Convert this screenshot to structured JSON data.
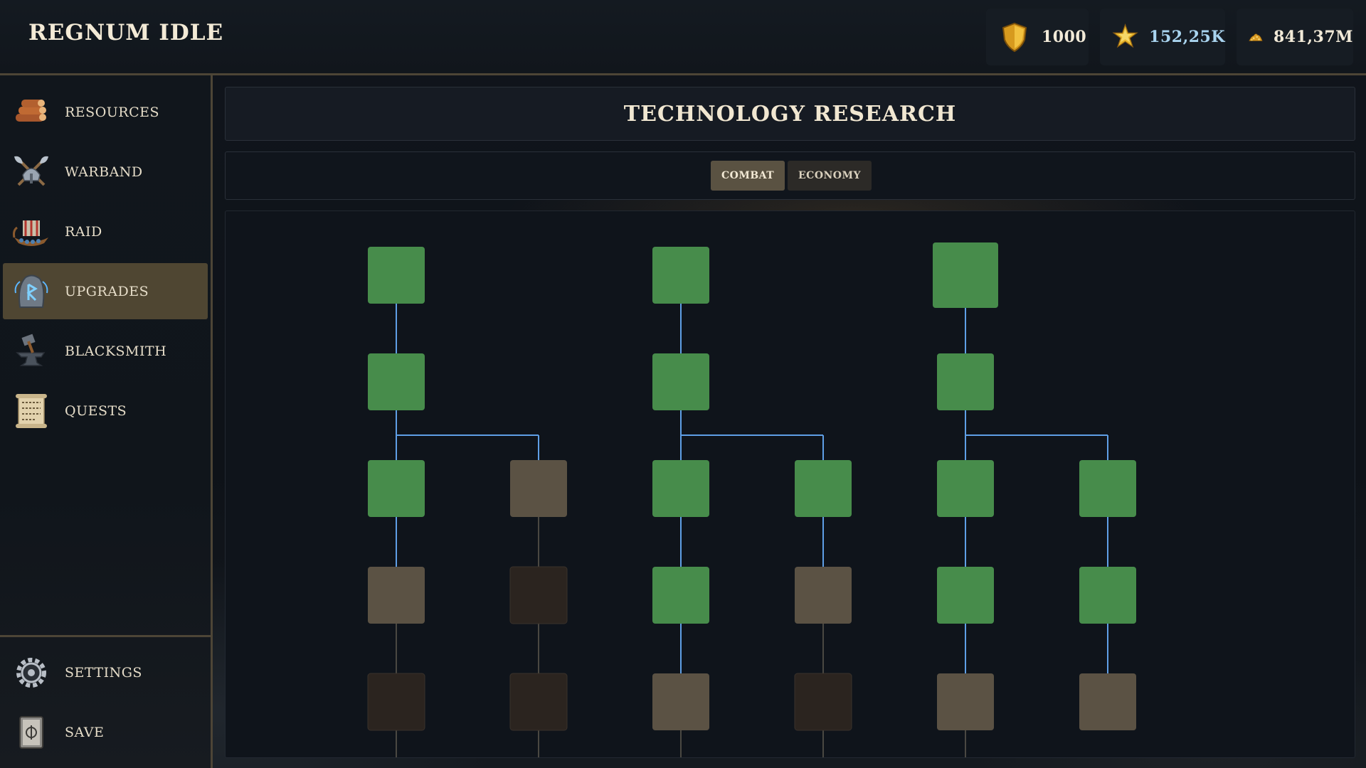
{
  "app": {
    "title": "REGNUM IDLE"
  },
  "resources": [
    {
      "name": "shield",
      "icon": "shield-icon",
      "value": "1000",
      "color": "#f2ead8"
    },
    {
      "name": "star",
      "icon": "star-icon",
      "value": "152,25K",
      "color": "#a9d4ef"
    },
    {
      "name": "gold",
      "icon": "gold-pile-icon",
      "value": "841,37M",
      "color": "#f2ead8"
    }
  ],
  "sidebar": {
    "items": [
      {
        "id": "resources",
        "label": "RESOURCES",
        "icon": "logs-icon",
        "active": false
      },
      {
        "id": "warband",
        "label": "WARBAND",
        "icon": "crossed-axes-helmet-icon",
        "active": false
      },
      {
        "id": "raid",
        "label": "RAID",
        "icon": "longship-icon",
        "active": false
      },
      {
        "id": "upgrades",
        "label": "UPGRADES",
        "icon": "rune-stone-icon",
        "active": true
      },
      {
        "id": "blacksmith",
        "label": "BLACKSMITH",
        "icon": "anvil-hammer-icon",
        "active": false
      },
      {
        "id": "quests",
        "label": "QUESTS",
        "icon": "scroll-icon",
        "active": false
      }
    ],
    "bottom_items": [
      {
        "id": "settings",
        "label": "SETTINGS",
        "icon": "gear-icon"
      },
      {
        "id": "save",
        "label": "SAVE",
        "icon": "book-icon"
      }
    ]
  },
  "main": {
    "title": "TECHNOLOGY RESEARCH",
    "tabs": [
      {
        "label": "COMBAT",
        "active": true
      },
      {
        "label": "ECONOMY",
        "active": false
      }
    ]
  },
  "colors": {
    "researched": "#478c4b",
    "available": "#5b5244",
    "locked": "#2b241f",
    "link_active": "#5f9fe6",
    "link_inactive": "#4a4842",
    "accent_active_nav": "#4f4632"
  },
  "tech_tree": {
    "columns": 8,
    "rows": 5,
    "nodes": [
      {
        "id": "a1",
        "col": 1,
        "row": 0,
        "state": "researched"
      },
      {
        "id": "a2",
        "col": 1,
        "row": 1,
        "state": "researched"
      },
      {
        "id": "a3",
        "col": 1,
        "row": 2,
        "state": "researched"
      },
      {
        "id": "a4",
        "col": 1,
        "row": 3,
        "state": "available"
      },
      {
        "id": "a5",
        "col": 1,
        "row": 4,
        "state": "locked"
      },
      {
        "id": "b3",
        "col": 2,
        "row": 2,
        "state": "available"
      },
      {
        "id": "b4",
        "col": 2,
        "row": 3,
        "state": "locked"
      },
      {
        "id": "b5",
        "col": 2,
        "row": 4,
        "state": "locked"
      },
      {
        "id": "c1",
        "col": 3,
        "row": 0,
        "state": "researched"
      },
      {
        "id": "c2",
        "col": 3,
        "row": 1,
        "state": "researched"
      },
      {
        "id": "c3",
        "col": 3,
        "row": 2,
        "state": "researched"
      },
      {
        "id": "c4",
        "col": 3,
        "row": 3,
        "state": "researched"
      },
      {
        "id": "c5",
        "col": 3,
        "row": 4,
        "state": "available"
      },
      {
        "id": "d3",
        "col": 4,
        "row": 2,
        "state": "researched"
      },
      {
        "id": "d4",
        "col": 4,
        "row": 3,
        "state": "available"
      },
      {
        "id": "d5",
        "col": 4,
        "row": 4,
        "state": "locked"
      },
      {
        "id": "e1",
        "col": 5,
        "row": 0,
        "state": "researched",
        "highlight": true
      },
      {
        "id": "e2",
        "col": 5,
        "row": 1,
        "state": "researched"
      },
      {
        "id": "e3",
        "col": 5,
        "row": 2,
        "state": "researched"
      },
      {
        "id": "e4",
        "col": 5,
        "row": 3,
        "state": "researched"
      },
      {
        "id": "e5",
        "col": 5,
        "row": 4,
        "state": "available"
      },
      {
        "id": "f3",
        "col": 6,
        "row": 2,
        "state": "researched"
      },
      {
        "id": "f4",
        "col": 6,
        "row": 3,
        "state": "researched"
      },
      {
        "id": "f5",
        "col": 6,
        "row": 4,
        "state": "available"
      }
    ],
    "links": [
      [
        "a1",
        "a2",
        true
      ],
      [
        "a2",
        "a3",
        true
      ],
      [
        "a2",
        "b3",
        true
      ],
      [
        "a3",
        "a4",
        true
      ],
      [
        "a4",
        "a5",
        false
      ],
      [
        "b3",
        "b4",
        false
      ],
      [
        "b4",
        "b5",
        false
      ],
      [
        "c1",
        "c2",
        true
      ],
      [
        "c2",
        "c3",
        true
      ],
      [
        "c2",
        "d3",
        true
      ],
      [
        "c3",
        "c4",
        true
      ],
      [
        "c4",
        "c5",
        true
      ],
      [
        "d3",
        "d4",
        true
      ],
      [
        "d4",
        "d5",
        false
      ],
      [
        "e1",
        "e2",
        true
      ],
      [
        "e2",
        "e3",
        true
      ],
      [
        "e2",
        "f3",
        true
      ],
      [
        "e3",
        "e4",
        true
      ],
      [
        "e4",
        "e5",
        true
      ],
      [
        "f3",
        "f4",
        true
      ],
      [
        "f4",
        "f5",
        true
      ]
    ],
    "open_links": [
      "a5",
      "b5",
      "c5",
      "d5",
      "e5"
    ]
  }
}
